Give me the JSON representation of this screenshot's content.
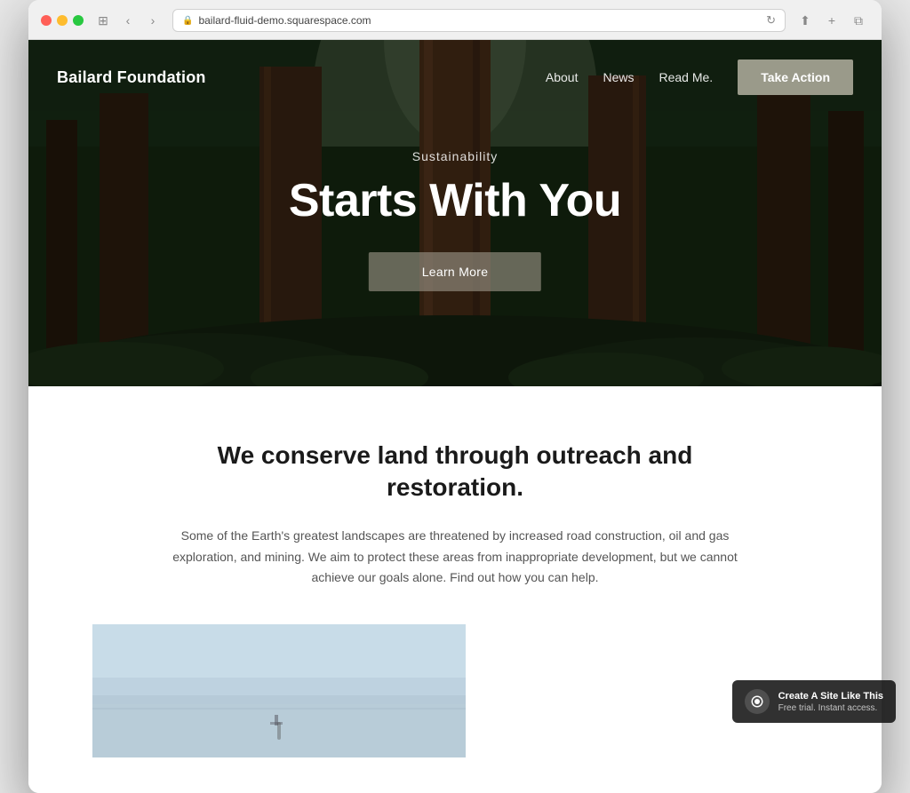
{
  "browser": {
    "url": "bailard-fluid-demo.squarespace.com",
    "back_label": "‹",
    "forward_label": "›",
    "reload_label": "↻",
    "share_label": "⬆",
    "new_tab_label": "+",
    "windows_label": "⧉"
  },
  "nav": {
    "logo": "Bailard Foundation",
    "links": [
      "About",
      "News",
      "Read Me."
    ],
    "cta": "Take Action"
  },
  "hero": {
    "subtitle": "Sustainability",
    "title": "Starts With You",
    "button": "Learn More"
  },
  "main": {
    "headline": "We conserve land through outreach and restoration.",
    "body": "Some of the Earth's greatest landscapes are threatened by increased road construction, oil and gas exploration, and mining. We aim to protect these areas from inappropriate development, but we cannot achieve our goals alone. Find out how you can help."
  },
  "badge": {
    "title": "Create A Site Like This",
    "subtitle": "Free trial. Instant access."
  }
}
